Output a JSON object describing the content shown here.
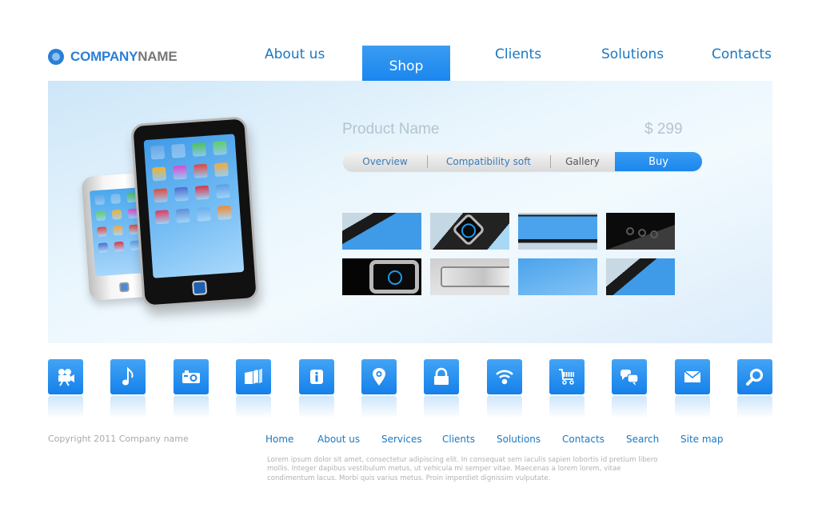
{
  "brand": {
    "name_part1": "COMPANY",
    "name_part2": "NAME",
    "accent": "#2a7fd6"
  },
  "nav": {
    "items": [
      {
        "label": "About us",
        "active": false
      },
      {
        "label": "Shop",
        "active": true
      },
      {
        "label": "Clients",
        "active": false
      },
      {
        "label": "Solutions",
        "active": false
      },
      {
        "label": "Contacts",
        "active": false
      }
    ]
  },
  "product": {
    "name": "Product Name",
    "price": "$ 299",
    "tabs": [
      {
        "label": "Overview"
      },
      {
        "label": "Compatibility soft"
      },
      {
        "label": "Gallery"
      },
      {
        "label": "Buy",
        "active": true
      }
    ],
    "gallery": [
      {
        "icon": "phone-corner-detail"
      },
      {
        "icon": "home-button-detail"
      },
      {
        "icon": "screen-bottom-detail"
      },
      {
        "icon": "speaker-holes-detail"
      },
      {
        "icon": "power-button-detail"
      },
      {
        "icon": "side-button-detail"
      },
      {
        "icon": "app-icons-detail"
      },
      {
        "icon": "phone-corner-detail"
      }
    ]
  },
  "icons": [
    {
      "name": "video-camera"
    },
    {
      "name": "music-note"
    },
    {
      "name": "photo-camera"
    },
    {
      "name": "book"
    },
    {
      "name": "info"
    },
    {
      "name": "location-pin"
    },
    {
      "name": "lock"
    },
    {
      "name": "wifi"
    },
    {
      "name": "shopping-cart"
    },
    {
      "name": "chat-bubbles"
    },
    {
      "name": "mail"
    },
    {
      "name": "search"
    }
  ],
  "footer": {
    "copyright": "Copyright 2011 Company name",
    "links": [
      "Home",
      "About us",
      "Services",
      "Clients",
      "Solutions",
      "Contacts",
      "Search",
      "Site map"
    ],
    "lorem": "Lorem ipsum dolor sit amet, consectetur adipiscing elit. In consequat sem iaculis sapien lobortis id pretium libero mollis. Integer dapibus vestibulum metus, ut vehicula mi semper vitae. Maecenas a lorem lorem, vitae condimentum lacus. Morbi quis varius metus. Proin imperdiet dignissim vulputate."
  }
}
